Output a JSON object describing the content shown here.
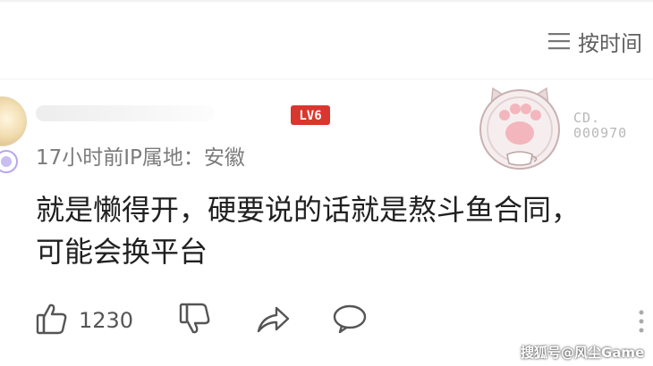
{
  "header": {
    "sort_label": "按时间",
    "sort_icon": "list-icon"
  },
  "comment": {
    "level_badge": "LV6",
    "meta": "17小时前IP属地：安徽",
    "decoration_code_line1": "CD.",
    "decoration_code_line2": "000970",
    "content_lines": [
      "就是懒得开，硬要说的话就是熬斗鱼合同，",
      "可能会换平台"
    ]
  },
  "actions": {
    "like_icon": "thumbs-up-icon",
    "like_count": "1230",
    "dislike_icon": "thumbs-down-icon",
    "share_icon": "share-icon",
    "reply_icon": "comment-bubble-icon",
    "more_icon": "more-vertical-icon"
  },
  "watermark": "搜狐号@风尘Game",
  "colors": {
    "level_badge": "#d9362f",
    "meta_text": "#7b7b7b",
    "body_text": "#202020",
    "icon": "#555555"
  }
}
